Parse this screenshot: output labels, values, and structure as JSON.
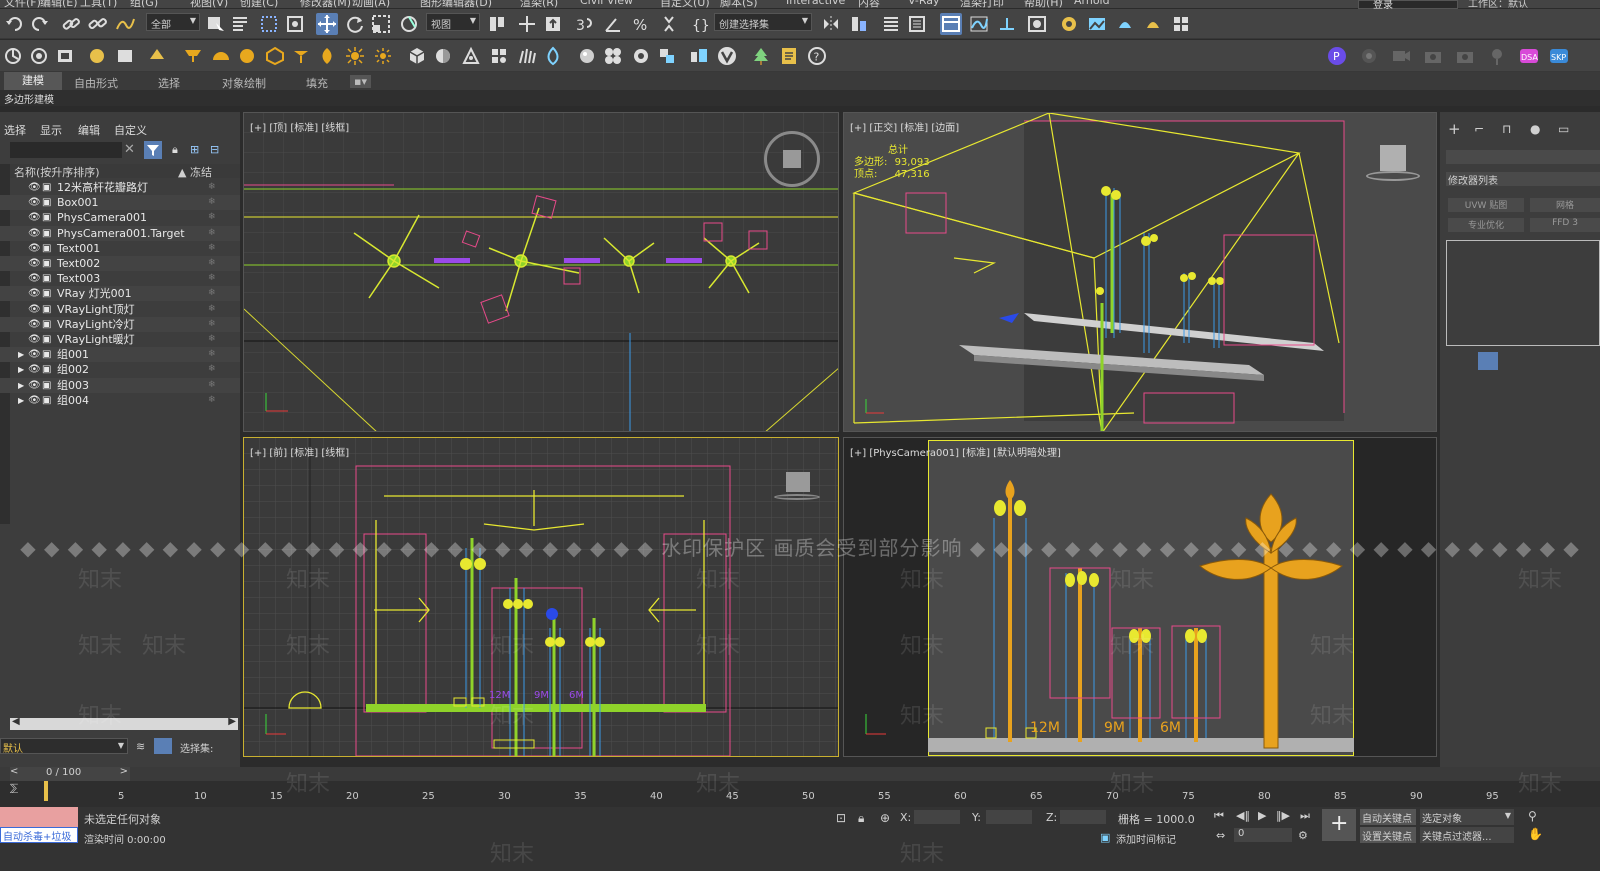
{
  "menu": [
    "文件(F)",
    "编辑(E)",
    "工具(T)",
    "组(G)",
    "视图(V)",
    "创建(C)",
    "修改器(M)",
    "动画(A)",
    "图形编辑器(D)",
    "渲染(R)",
    "Civil View",
    "自定义(U)",
    "脚本(S)",
    "Interactive",
    "内容",
    "V-Ray",
    "渲染打印",
    "帮助(H)",
    "Arnold"
  ],
  "top_right": {
    "login": "登录",
    "workspace": "工作区：默认"
  },
  "toolbar": {
    "filter": "全部",
    "ref_coord": "视图",
    "selection_set": "创建选择集"
  },
  "ribbon": {
    "tabs": [
      "建模",
      "自由形式",
      "选择",
      "对象绘制",
      "填充"
    ],
    "active": "建模",
    "sub": "多边形建模"
  },
  "scene": {
    "menus": [
      "选择",
      "显示",
      "编辑",
      "自定义"
    ],
    "col_name": "名称(按升序排序)",
    "col_freeze": "▲ 冻结",
    "items": [
      "12米高杆花瓣路灯",
      "Box001",
      "PhysCamera001",
      "PhysCamera001.Target",
      "Text001",
      "Text002",
      "Text003",
      "VRay 灯光001",
      "VRayLight顶灯",
      "VRayLight冷灯",
      "VRayLight暖灯",
      "组001",
      "组002",
      "组003",
      "组004"
    ],
    "layer": "默认",
    "selection_set_label": "选择集:"
  },
  "viewports": {
    "top": "[+] [顶] [标准] [线框]",
    "ortho": "[+] [正交] [标准] [边面]",
    "front": "[+] [前] [标准] [线框]",
    "camera": "[+] [PhysCamera001] [标准] [默认明暗处理]",
    "stats": {
      "total": "总计",
      "poly_label": "多边形:",
      "poly": "93,093",
      "vert_label": "顶点:",
      "vert": "47,316"
    }
  },
  "labels": {
    "m12": "12M",
    "m9": "9M",
    "m6": "6M"
  },
  "right": {
    "modifier_list": "修改器列表",
    "btn1": "UVW 贴图",
    "btn2": "网格",
    "btn3": "专业优化",
    "btn4": "FFD 3"
  },
  "timeline": {
    "frame": "0 / 100",
    "ticks": [
      "5",
      "10",
      "15",
      "20",
      "25",
      "30",
      "35",
      "40",
      "45",
      "50",
      "55",
      "60",
      "65",
      "70",
      "75",
      "80",
      "85",
      "90",
      "95"
    ]
  },
  "status": {
    "msg1": "未选定任何对象",
    "msg2": "渲染时间  0:00:00",
    "x": "X:",
    "y": "Y:",
    "z": "Z:",
    "grid": "栅格 = 1000.0",
    "add_tag": "添加时间标记",
    "autokey": "自动关键点",
    "setkey": "设置关键点",
    "sel_obj": "选定对象",
    "key_filter": "关键点过滤器...",
    "frame_val": "0",
    "mini": "自动杀毒+垃圾"
  },
  "watermark": {
    "center": "水印保护区  画质会受到部分影响",
    "repeat": "知末"
  }
}
